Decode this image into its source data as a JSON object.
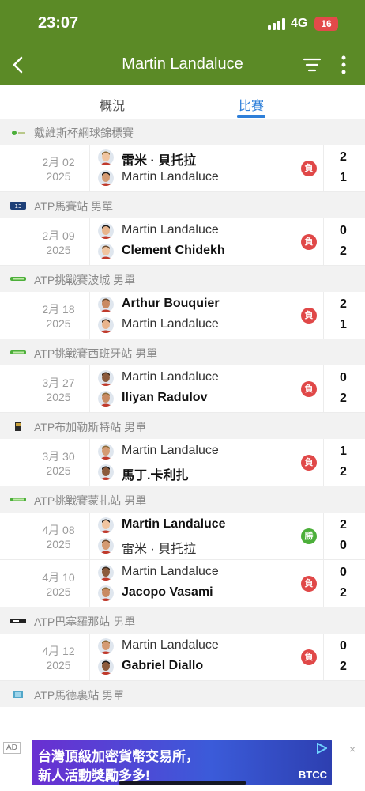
{
  "status": {
    "time": "23:07",
    "network": "4G",
    "battery": "16"
  },
  "header": {
    "title": "Martin Landaluce"
  },
  "tabs": [
    {
      "label": "概況"
    },
    {
      "label": "比賽"
    }
  ],
  "colors": {
    "header_bg": "#5b8a26",
    "tab_active": "#2e7fd9",
    "loss": "#e04848",
    "win": "#4caf3a"
  },
  "sections": [
    {
      "name": "戴維斯杯網球錦標賽",
      "logo_icon": "davis-cup-logo",
      "matches": [
        {
          "date": "2月 02",
          "year": "2025",
          "result": "負",
          "outcome": "loss",
          "players": [
            {
              "name": "雷米 · 貝托拉",
              "score": "2",
              "winner": true
            },
            {
              "name": "Martin Landaluce",
              "score": "1",
              "winner": false
            }
          ]
        }
      ]
    },
    {
      "name": "ATP馬賽站 男單",
      "logo_icon": "atp-250-logo",
      "matches": [
        {
          "date": "2月 09",
          "year": "2025",
          "result": "負",
          "outcome": "loss",
          "players": [
            {
              "name": "Martin Landaluce",
              "score": "0",
              "winner": false
            },
            {
              "name": "Clement Chidekh",
              "score": "2",
              "winner": true
            }
          ]
        }
      ]
    },
    {
      "name": "ATP挑戰賽波城 男單",
      "logo_icon": "atp-challenger-logo",
      "matches": [
        {
          "date": "2月 18",
          "year": "2025",
          "result": "負",
          "outcome": "loss",
          "players": [
            {
              "name": "Arthur Bouquier",
              "score": "2",
              "winner": true
            },
            {
              "name": "Martin Landaluce",
              "score": "1",
              "winner": false
            }
          ]
        }
      ]
    },
    {
      "name": "ATP挑戰賽西班牙站 男單",
      "logo_icon": "atp-challenger-logo",
      "matches": [
        {
          "date": "3月 27",
          "year": "2025",
          "result": "負",
          "outcome": "loss",
          "players": [
            {
              "name": "Martin Landaluce",
              "score": "0",
              "winner": false
            },
            {
              "name": "Iliyan Radulov",
              "score": "2",
              "winner": true
            }
          ]
        }
      ]
    },
    {
      "name": "ATP布加勒斯特站 男單",
      "logo_icon": "bucharest-logo",
      "matches": [
        {
          "date": "3月 30",
          "year": "2025",
          "result": "負",
          "outcome": "loss",
          "players": [
            {
              "name": "Martin Landaluce",
              "score": "1",
              "winner": false
            },
            {
              "name": "馬丁.卡利扎",
              "score": "2",
              "winner": true
            }
          ]
        }
      ]
    },
    {
      "name": "ATP挑戰賽蒙扎站 男單",
      "logo_icon": "atp-challenger-logo",
      "matches": [
        {
          "date": "4月 08",
          "year": "2025",
          "result": "勝",
          "outcome": "win",
          "players": [
            {
              "name": "Martin Landaluce",
              "score": "2",
              "winner": true
            },
            {
              "name": "雷米 · 貝托拉",
              "score": "0",
              "winner": false
            }
          ]
        },
        {
          "date": "4月 10",
          "year": "2025",
          "result": "負",
          "outcome": "loss",
          "players": [
            {
              "name": "Martin Landaluce",
              "score": "0",
              "winner": false
            },
            {
              "name": "Jacopo Vasami",
              "score": "2",
              "winner": true
            }
          ]
        }
      ]
    },
    {
      "name": "ATP巴塞羅那站 男單",
      "logo_icon": "barcelona-logo",
      "matches": [
        {
          "date": "4月 12",
          "year": "2025",
          "result": "負",
          "outcome": "loss",
          "players": [
            {
              "name": "Martin Landaluce",
              "score": "0",
              "winner": false
            },
            {
              "name": "Gabriel Diallo",
              "score": "2",
              "winner": true
            }
          ]
        }
      ]
    },
    {
      "name": "ATP馬德裏站 男單",
      "logo_icon": "madrid-logo",
      "matches": []
    }
  ],
  "ad": {
    "label": "AD",
    "line1": "台灣頂級加密貨幣交易所，",
    "line2": "新人活動獎勵多多!",
    "brand": "BTCC",
    "close": "×"
  }
}
